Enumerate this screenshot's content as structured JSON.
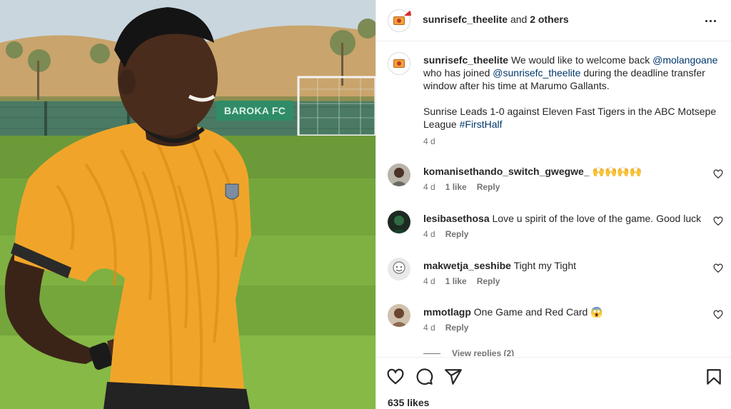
{
  "photo": {
    "sign_text": "BAROKA FC"
  },
  "header": {
    "username": "sunrisefc_theelite",
    "connector": " and ",
    "others": "2 others",
    "more_icon": "more-horizontal-icon"
  },
  "caption": {
    "username": "sunrisefc_theelite",
    "text_1": " We would like to welcome back ",
    "mention_1": "@molangoane",
    "text_2": " who has joined ",
    "mention_2": "@sunrisefc_theelite",
    "text_3": " during the deadline transfer window after his time at Marumo Gallants.",
    "para2_text": "Sunrise Leads 1-0 against Eleven Fast Tigers in the ABC Motsepe League ",
    "hashtag": "#FirstHalf",
    "time": "4 d"
  },
  "comments": [
    {
      "username": "komanisethando_switch_gwegwe_",
      "text": "🙌🙌🙌🙌",
      "time": "4 d",
      "likes": "1 like",
      "reply": "Reply"
    },
    {
      "username": "lesibasethosa",
      "text": "Love u spirit of the love of the game. Good luck",
      "time": "4 d",
      "likes": "",
      "reply": "Reply"
    },
    {
      "username": "makwetja_seshibe",
      "text": "Tight my Tight",
      "time": "4 d",
      "likes": "1 like",
      "reply": "Reply"
    },
    {
      "username": "mmotlagp",
      "text": "One Game and Red Card 😱",
      "time": "4 d",
      "likes": "",
      "reply": "Reply"
    }
  ],
  "view_replies": "View replies (2)",
  "actions": {
    "like_icon": "heart-icon",
    "comment_icon": "comment-icon",
    "share_icon": "share-icon",
    "save_icon": "bookmark-icon"
  },
  "likes": "635 likes"
}
